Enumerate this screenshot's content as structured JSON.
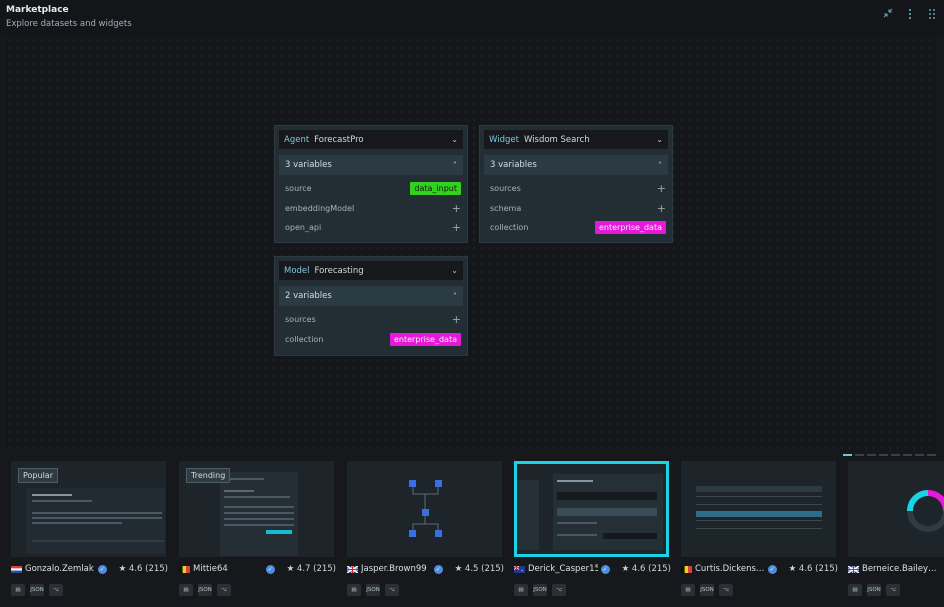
{
  "header": {
    "title": "Marketplace",
    "subtitle": "Explore datasets and widgets",
    "icons": [
      "collapse-icon",
      "more-vertical-icon",
      "grid-dots-icon"
    ]
  },
  "nodes": [
    {
      "kind": "Agent",
      "name": "ForecastPro",
      "vars_label": "3 variables",
      "rows": [
        {
          "label": "source",
          "value": "data_input",
          "color": "#32d11f"
        },
        {
          "label": "embeddingModel",
          "value": null
        },
        {
          "label": "open_api",
          "value": null
        }
      ]
    },
    {
      "kind": "Widget",
      "name": "Wisdom Search",
      "vars_label": "3 variables",
      "rows": [
        {
          "label": "sources",
          "value": null
        },
        {
          "label": "schema",
          "value": null
        },
        {
          "label": "collection",
          "value": "enterprise_data",
          "color": "#e41ad8"
        }
      ]
    },
    {
      "kind": "Model",
      "name": "Forecasting",
      "vars_label": "2 variables",
      "rows": [
        {
          "label": "sources",
          "value": null
        },
        {
          "label": "collection",
          "value": "enterprise_data",
          "color": "#e41ad8"
        }
      ]
    }
  ],
  "gallery": {
    "pager": {
      "count": 8,
      "active": 0
    },
    "action_labels": [
      "",
      "JSON",
      ""
    ],
    "items": [
      {
        "tag": "Popular",
        "author": "Gonzalo.Zemlak",
        "flag": "hr",
        "rating": "★ 4.6 (215)"
      },
      {
        "tag": "Trending",
        "author": "Mittie64",
        "flag": "be",
        "rating": "★ 4.7 (215)"
      },
      {
        "tag": "",
        "author": "Jasper.Brown99",
        "flag": "gb",
        "rating": "★ 4.5 (215)"
      },
      {
        "tag": "",
        "author": "Derick_Casper15",
        "flag": "au",
        "rating": "★ 4.6 (215)",
        "selected": true
      },
      {
        "tag": "",
        "author": "Curtis.Dickens…",
        "flag": "be",
        "rating": "★ 4.6 (215)"
      },
      {
        "tag": "",
        "author": "Berneice.Bailey…",
        "flag": "gb",
        "rating": ""
      }
    ]
  }
}
